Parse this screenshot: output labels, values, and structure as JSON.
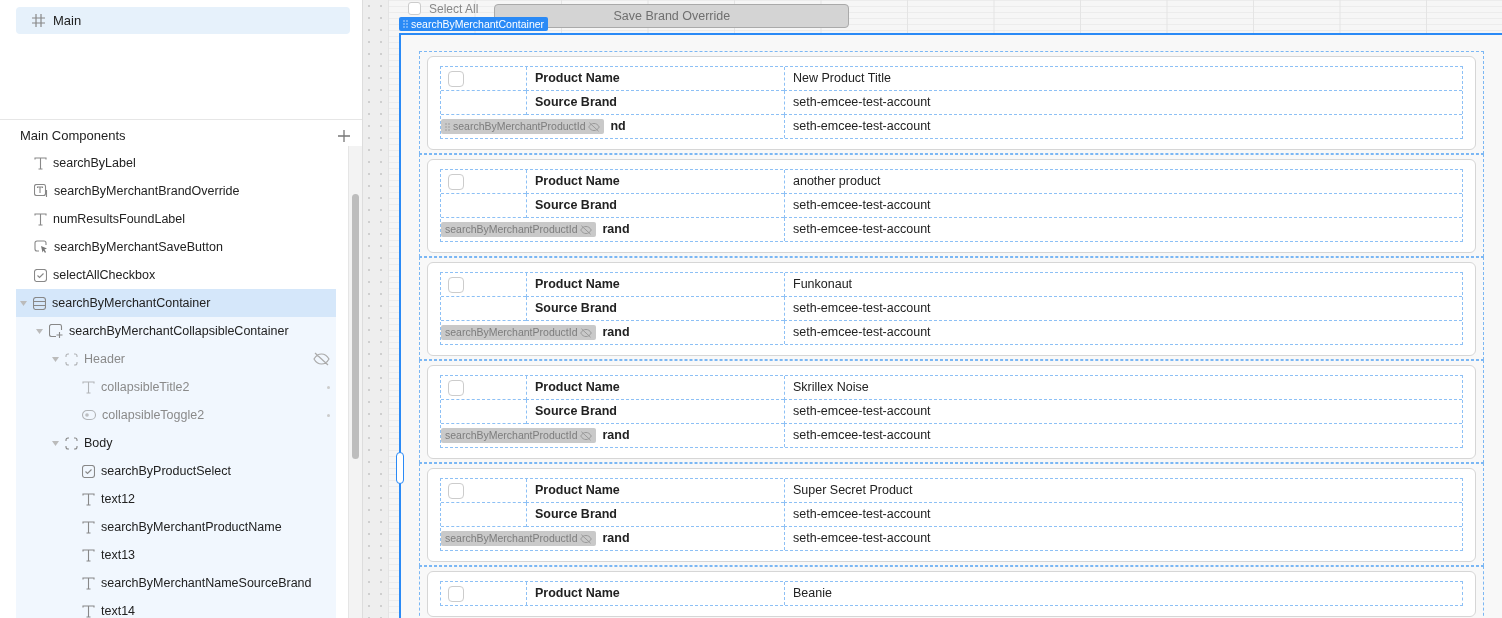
{
  "left_panel": {
    "pages": [
      {
        "label": "Main",
        "selected": true
      }
    ],
    "components_header": "Main Components",
    "tree": [
      {
        "label": "searchByLabel",
        "kind": "text",
        "selected": false,
        "hidden": false
      },
      {
        "label": "searchByMerchantBrandOverride",
        "kind": "text-input",
        "selected": false,
        "hidden": false
      },
      {
        "label": "numResultsFoundLabel",
        "kind": "text",
        "selected": false,
        "hidden": false
      },
      {
        "label": "searchByMerchantSaveButton",
        "kind": "button",
        "selected": false,
        "hidden": false
      },
      {
        "label": "selectAllCheckbox",
        "kind": "checkbox",
        "selected": false,
        "hidden": false
      },
      {
        "label": "searchByMerchantContainer",
        "kind": "container",
        "selected": true,
        "hidden": false,
        "expanded": true,
        "children": [
          {
            "label": "searchByMerchantCollapsibleContainer",
            "kind": "collapsible",
            "selected": false,
            "hidden": false,
            "expanded": true,
            "children": [
              {
                "label": "Header",
                "kind": "frame",
                "selected": false,
                "hidden": true,
                "expanded": true,
                "children": [
                  {
                    "label": "collapsibleTitle2",
                    "kind": "text",
                    "selected": false,
                    "hidden": true
                  },
                  {
                    "label": "collapsibleToggle2",
                    "kind": "toggle",
                    "selected": false,
                    "hidden": true
                  }
                ]
              },
              {
                "label": "Body",
                "kind": "frame",
                "selected": false,
                "hidden": false,
                "expanded": true,
                "children": [
                  {
                    "label": "searchByProductSelect",
                    "kind": "checkbox",
                    "selected": false,
                    "hidden": false
                  },
                  {
                    "label": "text12",
                    "kind": "text",
                    "selected": false,
                    "hidden": false
                  },
                  {
                    "label": "searchByMerchantProductName",
                    "kind": "text",
                    "selected": false,
                    "hidden": false
                  },
                  {
                    "label": "text13",
                    "kind": "text",
                    "selected": false,
                    "hidden": false
                  },
                  {
                    "label": "searchByMerchantNameSourceBrand",
                    "kind": "text",
                    "selected": false,
                    "hidden": false
                  },
                  {
                    "label": "text14",
                    "kind": "text",
                    "selected": false,
                    "hidden": false
                  }
                ]
              }
            ]
          }
        ]
      }
    ]
  },
  "canvas": {
    "select_all": {
      "label": "Select All",
      "checked": false
    },
    "save_button": {
      "label": "Save Brand Override",
      "disabled": true
    },
    "container_tag": "searchByMerchantContainer",
    "cards": [
      {
        "checked": false,
        "overlay_tag": {
          "label": "searchByMerchantProductId",
          "grip": true
        },
        "rows": [
          {
            "label": "Product Name",
            "value": "New Product Title"
          },
          {
            "label": "Source Brand",
            "value": "seth-emcee-test-account"
          },
          {
            "label": "nd",
            "value": "seth-emcee-test-account"
          }
        ]
      },
      {
        "checked": false,
        "overlay_tag": {
          "label": "searchByMerchantProductId",
          "grip": false
        },
        "rows": [
          {
            "label": "Product Name",
            "value": "another product"
          },
          {
            "label": "Source Brand",
            "value": "seth-emcee-test-account"
          },
          {
            "label": "rand",
            "value": "seth-emcee-test-account"
          }
        ]
      },
      {
        "checked": false,
        "overlay_tag": {
          "label": "searchByMerchantProductId",
          "grip": false
        },
        "rows": [
          {
            "label": "Product Name",
            "value": "Funkonaut"
          },
          {
            "label": "Source Brand",
            "value": "seth-emcee-test-account"
          },
          {
            "label": "rand",
            "value": "seth-emcee-test-account"
          }
        ]
      },
      {
        "checked": false,
        "overlay_tag": {
          "label": "searchByMerchantProductId",
          "grip": false
        },
        "rows": [
          {
            "label": "Product Name",
            "value": "Skrillex Noise"
          },
          {
            "label": "Source Brand",
            "value": "seth-emcee-test-account"
          },
          {
            "label": "rand",
            "value": "seth-emcee-test-account"
          }
        ]
      },
      {
        "checked": false,
        "overlay_tag": {
          "label": "searchByMerchantProductId",
          "grip": false
        },
        "rows": [
          {
            "label": "Product Name",
            "value": "Super Secret Product"
          },
          {
            "label": "Source Brand",
            "value": "seth-emcee-test-account"
          },
          {
            "label": "rand",
            "value": "seth-emcee-test-account"
          }
        ]
      },
      {
        "checked": false,
        "rows": [
          {
            "label": "Product Name",
            "value": "Beanie"
          }
        ]
      }
    ]
  }
}
